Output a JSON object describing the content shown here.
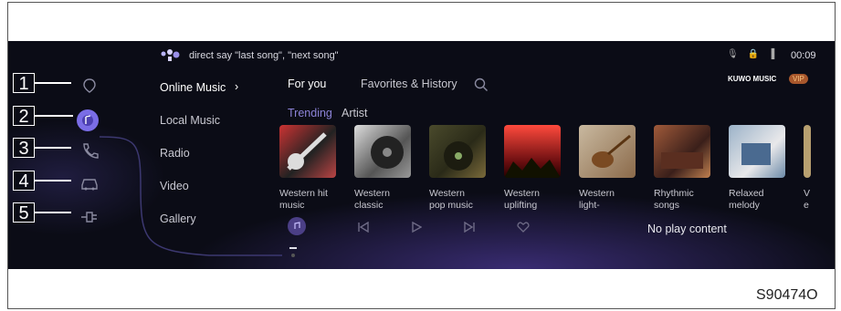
{
  "status_bar": {
    "voice_hint": "direct say \"last song\", \"next song\"",
    "clock": "00:09",
    "icons": [
      "microphone-icon",
      "lock-icon",
      "signal-icon"
    ]
  },
  "callouts": [
    "1",
    "2",
    "3",
    "4",
    "5"
  ],
  "sidebar_icons": [
    "navigation-icon",
    "music-icon",
    "phone-icon",
    "car-icon",
    "plug-icon"
  ],
  "left_menu": {
    "items": [
      "Online Music",
      "Local Music",
      "Radio",
      "Video",
      "Gallery"
    ],
    "active_chevron": "›"
  },
  "tabs": {
    "for_you": "For you",
    "favorites": "Favorites & History"
  },
  "subtabs": {
    "trending": "Trending",
    "artist": "Artist"
  },
  "brand": {
    "logo": "KUWO MUSIC",
    "vip": "VIP"
  },
  "cards": [
    {
      "line1": "Western hit",
      "line2": "music"
    },
    {
      "line1": "Western",
      "line2": "classic"
    },
    {
      "line1": "Western",
      "line2": "pop music"
    },
    {
      "line1": "Western",
      "line2": "uplifting"
    },
    {
      "line1": "Western",
      "line2": "light-"
    },
    {
      "line1": "Rhythmic",
      "line2": "songs"
    },
    {
      "line1": "Relaxed",
      "line2": "melody"
    },
    {
      "line1": "V",
      "line2": "e"
    }
  ],
  "player": {
    "status": "No play content"
  },
  "figure_code": "S90474O",
  "colors": {
    "background": "#0b0c16",
    "accent": "#8c83d8",
    "glow": "#5f46be"
  }
}
